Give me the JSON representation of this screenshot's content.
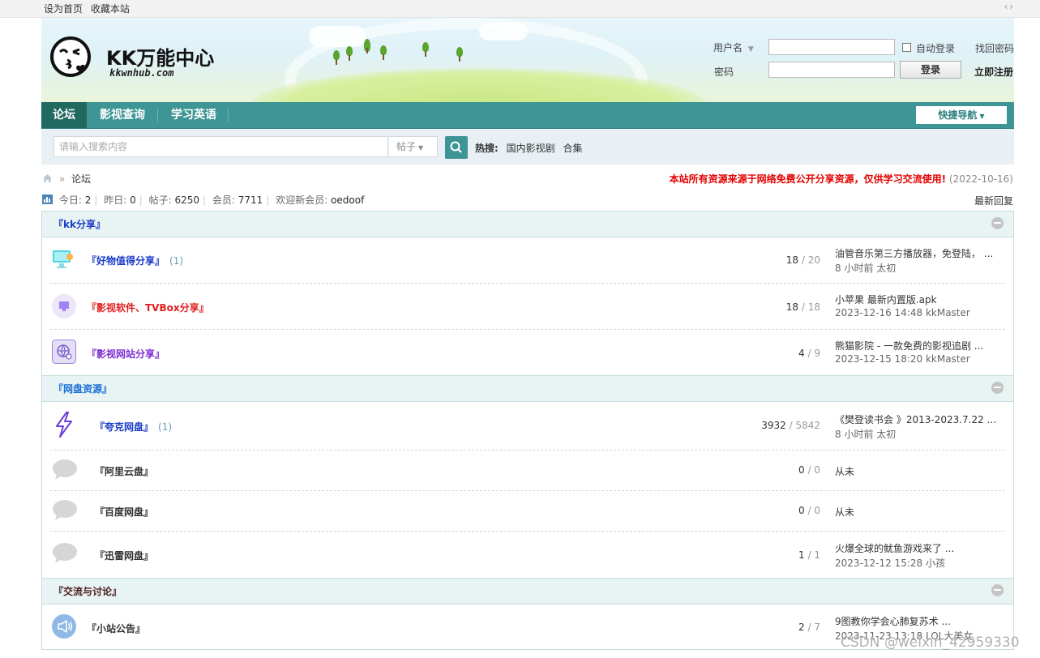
{
  "topbar": {
    "set_home": "设为首页",
    "bookmark": "收藏本站",
    "toggle": "‹ ›"
  },
  "header": {
    "site_name": "KK万能中心",
    "site_domain": "kkwnhub.com",
    "login": {
      "username_label": "用户名",
      "password_label": "密码",
      "auto_login": "自动登录",
      "login_button": "登录",
      "find_password": "找回密码",
      "register": "立即注册"
    }
  },
  "nav": {
    "items": [
      "论坛",
      "影视查询",
      "学习英语"
    ],
    "active": "论坛",
    "quick_nav": "快捷导航"
  },
  "search": {
    "placeholder": "请输入搜索内容",
    "type": "帖子",
    "hot_label": "热搜:",
    "hot_terms": [
      "国内影视剧",
      "合集"
    ]
  },
  "breadcrumb": {
    "separator": "»",
    "current": "论坛"
  },
  "notice": {
    "text": "本站所有资源来源于网络免费公开分享资源，仅供学习交流使用!",
    "date": "(2022-10-16)"
  },
  "stats": {
    "today_label": "今日:",
    "today": "2",
    "yesterday_label": "昨日:",
    "yesterday": "0",
    "posts_label": "帖子:",
    "posts": "6250",
    "members_label": "会员:",
    "members": "7711",
    "newest_label": "欢迎新会员:",
    "newest": "oedoof"
  },
  "latest_replies": "最新回复",
  "sections": [
    {
      "title": "『kk分享』",
      "forums": [
        {
          "name": "『好物值得分享』",
          "today": "(1)",
          "threads": "18",
          "posts": "20",
          "last_title": "油管音乐第三方播放器，免登陆， ...",
          "last_meta": "8 小时前 太初"
        },
        {
          "name": "『影视软件、TVBox分享』",
          "today": "",
          "threads": "18",
          "posts": "18",
          "last_title": "小苹果 最新内置版.apk",
          "last_meta": "2023-12-16 14:48 kkMaster"
        },
        {
          "name": "『影视网站分享』",
          "today": "",
          "threads": "4",
          "posts": "9",
          "last_title": "熊猫影院 - 一款免费的影视追剧 ...",
          "last_meta": "2023-12-15 18:20 kkMaster"
        }
      ]
    },
    {
      "title": "『网盘资源』",
      "forums": [
        {
          "name": "『夸克网盘』",
          "today": "(1)",
          "threads": "3932",
          "posts": "5842",
          "last_title": "《樊登读书会 》2013-2023.7.22 ...",
          "last_meta": "8 小时前 太初"
        },
        {
          "name": "『阿里云盘』",
          "today": "",
          "threads": "0",
          "posts": "0",
          "last_title": "从未",
          "last_meta": ""
        },
        {
          "name": "『百度网盘』",
          "today": "",
          "threads": "0",
          "posts": "0",
          "last_title": "从未",
          "last_meta": ""
        },
        {
          "name": "『迅雷网盘』",
          "today": "",
          "threads": "1",
          "posts": "1",
          "last_title": "火爆全球的鱿鱼游戏来了 ...",
          "last_meta": "2023-12-12 15:28 小孩"
        }
      ]
    },
    {
      "title": "『交流与讨论』",
      "forums": [
        {
          "name": "『小站公告』",
          "today": "",
          "threads": "2",
          "posts": "7",
          "last_title": "9图教你学会心肺复苏术 ...",
          "last_meta": "2023-11-23 13:18 LOL大美女"
        }
      ]
    }
  ],
  "colors": {
    "nav_bg": "#3e9595",
    "forum_blue": "#1a3dc8",
    "forum_red": "#e02020",
    "forum_purple": "#7b2fd0",
    "section_blue": "#1a6fd6",
    "section_dark": "#333333",
    "notice_red": "#e60000"
  },
  "watermark": "CSDN @weixin_42959330"
}
